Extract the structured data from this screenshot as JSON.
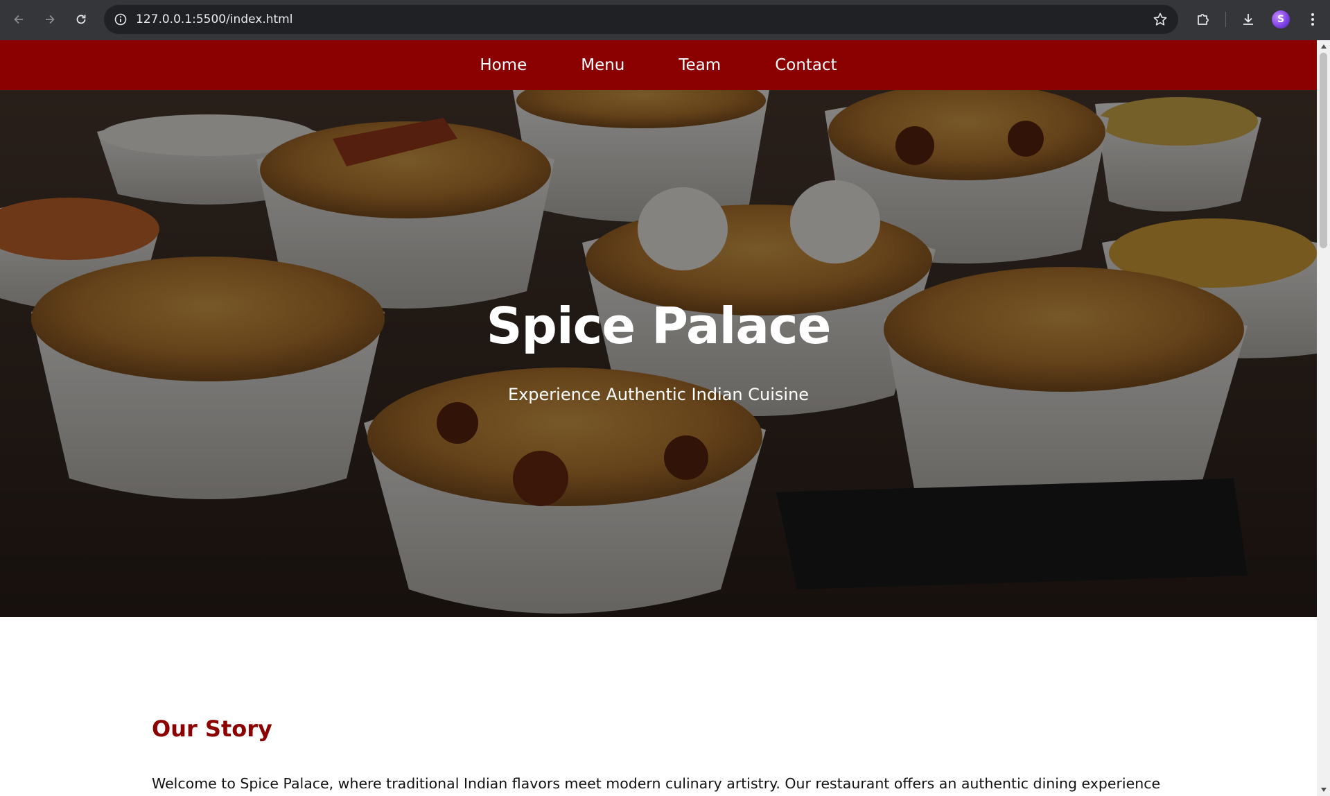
{
  "browser": {
    "url": "127.0.0.1:5500/index.html",
    "icons": {
      "back": "arrow-left-icon",
      "forward": "arrow-right-icon",
      "reload": "reload-icon",
      "site_info": "info-icon",
      "bookmark": "star-icon",
      "extensions": "puzzle-icon",
      "downloads": "download-icon",
      "profile": "avatar",
      "menu": "kebab-menu-icon"
    },
    "profile_initial": "S"
  },
  "site": {
    "nav": [
      "Home",
      "Menu",
      "Team",
      "Contact"
    ],
    "nav_color": "#8b0000",
    "hero": {
      "title": "Spice Palace",
      "subtitle": "Experience Authentic Indian Cuisine"
    },
    "story": {
      "heading": "Our Story",
      "heading_color": "#8b0000",
      "body": "Welcome to Spice Palace, where traditional Indian flavors meet modern culinary artistry. Our restaurant offers an authentic dining experience with carefully selected spices and fresh ingredients, bringing you the true taste of India."
    }
  }
}
